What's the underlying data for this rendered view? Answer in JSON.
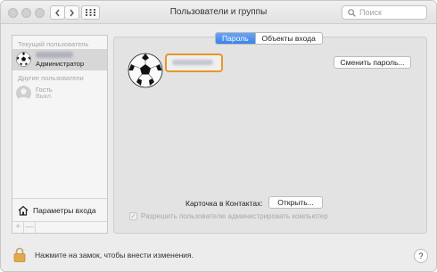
{
  "window": {
    "title": "Пользователи и группы",
    "search_placeholder": "Поиск"
  },
  "sidebar": {
    "current_user_label": "Текущий пользователь",
    "current_user": {
      "role": "Администратор",
      "name_blurred": true
    },
    "other_users_label": "Другие пользователи",
    "other_users": [
      {
        "name": "Гость",
        "status": "Выкл."
      }
    ],
    "login_options_label": "Параметры входа",
    "add_symbol": "+",
    "remove_symbol": "—"
  },
  "tabs": [
    {
      "label": "Пароль",
      "active": true
    },
    {
      "label": "Объекты входа",
      "active": false
    }
  ],
  "main": {
    "change_password_button": "Сменить пароль...",
    "contacts_card_label": "Карточка в Контактах:",
    "open_button": "Открыть...",
    "allow_admin_label": "Разрешить пользователю администрировать компьютер",
    "allow_admin_checked": true,
    "allow_admin_enabled": false
  },
  "footer": {
    "lock_text": "Нажмите на замок, чтобы внести изменения.",
    "help_symbol": "?"
  },
  "icons": {
    "avatar": "soccer-ball-icon",
    "lock": "lock-icon",
    "login_options": "house-icon",
    "grid": "grid-icon",
    "search": "search-icon"
  },
  "colors": {
    "accent": "#3b82ec",
    "highlight_border": "#e8962b"
  }
}
